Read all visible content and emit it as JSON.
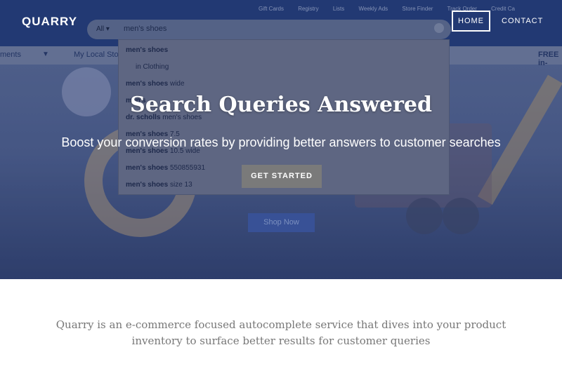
{
  "header": {
    "brand": "QUARRY",
    "nav": {
      "home": "HOME",
      "contact": "CONTACT"
    }
  },
  "background_store": {
    "utility_links": [
      "Gift Cards",
      "Registry",
      "Lists",
      "Weekly Ads",
      "Store Finder",
      "Track Order",
      "Credit Ca"
    ],
    "nav_left": "ments",
    "nav_local_store": "My Local Stor",
    "nav_right": "FREE in-",
    "search": {
      "department": "All",
      "value": "men's shoes"
    },
    "suggestions": [
      {
        "bold": "men's shoes",
        "rest": ""
      },
      {
        "bold": "",
        "rest": "in Clothing"
      },
      {
        "bold": "men's shoes",
        "rest": " wide"
      },
      {
        "bold": "men's",
        "rest": " ..."
      },
      {
        "bold": "dr. scholls ",
        "rest": "men's shoes"
      },
      {
        "bold": "men's shoes",
        "rest": " 7.5"
      },
      {
        "bold": "men's shoes",
        "rest": " 10.5 wide"
      },
      {
        "bold": "men's shoes",
        "rest": " 550855931"
      },
      {
        "bold": "men's shoes",
        "rest": " size 13"
      }
    ],
    "promo_button": "Shop Now"
  },
  "hero": {
    "title": "Search Queries Answered",
    "subtitle": "Boost your conversion rates by providing better answers to customer searches",
    "cta": "GET STARTED"
  },
  "about": {
    "text": "Quarry is an e-commerce focused autocomplete service that dives into your product inventory to surface better results for customer queries"
  },
  "colors": {
    "hero_base": "#4c5d8c",
    "cta_bg": "#7a7a7a",
    "body_text": "#777777"
  }
}
